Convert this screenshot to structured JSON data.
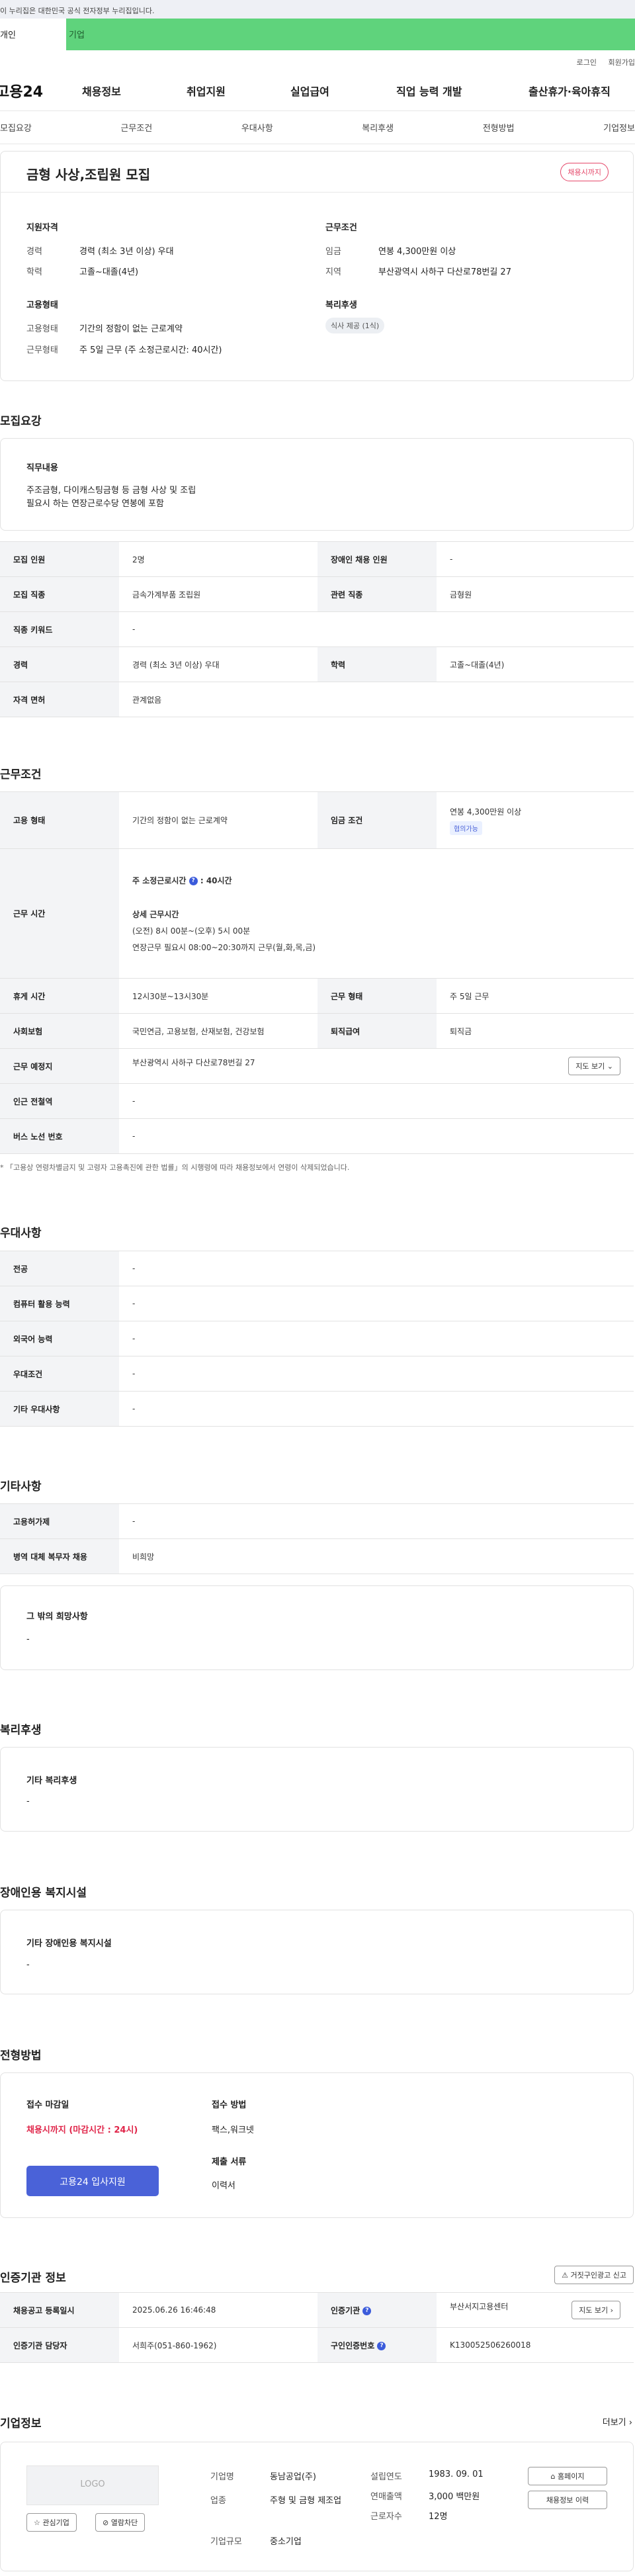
{
  "gov_banner": "이 누리집은 대한민국 공식 전자정부 누리집입니다.",
  "type_tabs": {
    "individual": "개인",
    "company": "기업"
  },
  "util": {
    "login": "로그인",
    "join": "회원가입"
  },
  "logo": "고용24",
  "gnb": [
    "채용정보",
    "취업지원",
    "실업급여",
    "직업 능력 개발",
    "출산휴가·육아휴직"
  ],
  "tabs": [
    "모집요강",
    "근무조건",
    "우대사항",
    "복리후생",
    "전형방법",
    "기업정보"
  ],
  "job": {
    "title": "금형 사상,조립원 모집",
    "badge": "채용시까지"
  },
  "summary": {
    "qual_title": "지원자격",
    "career_label": "경력",
    "career": "경력 (최소 3년 이상) 우대",
    "edu_label": "학력",
    "edu": "고졸~대졸(4년)",
    "cond_title": "근무조건",
    "wage_label": "임금",
    "wage": "연봉 4,300만원 이상",
    "area_label": "지역",
    "area": "부산광역시 사하구 다산로78번길 27",
    "emp_title": "고용형태",
    "emptype_label": "고용형태",
    "emptype": "기간의 정함이 없는 근로계약",
    "form_label": "근무형태",
    "form": "주 5일 근무 (주 소정근로시간: 40시간)",
    "welfare_title": "복리후생",
    "welfare": "식사 제공 (1식)"
  },
  "recruit": {
    "section": "모집요강",
    "duty_title": "직무내용",
    "duty_line1": "주조금형, 다이캐스팅금형 등 금형 사상 및 조립",
    "duty_line2": "필요시 하는 연장근로수당 연봉에 포함",
    "rows": [
      [
        "모집 인원",
        "2명",
        "장애인 채용 인원",
        "-"
      ],
      [
        "모집 직종",
        "금속가계부품 조립원",
        "관련 직종",
        "금형원"
      ],
      [
        "직종 키워드",
        "-"
      ],
      [
        "경력",
        "경력 (최소 3년 이상) 우대",
        "학력",
        "고졸~대졸(4년)"
      ],
      [
        "자격 면허",
        "관계없음"
      ]
    ]
  },
  "work": {
    "section": "근무조건",
    "emp_label": "고용 형태",
    "emp": "기간의 정함이 없는 근로계약",
    "wage_label": "임금 조건",
    "wage": "연봉 4,300만원 이상",
    "wage_tag": "협의가능",
    "time_label": "근무 시간",
    "weekly": "주 소정근로시간",
    "weekly_val": ": 40시간",
    "detail_title": "상세 근무시간",
    "detail1": "(오전) 8시 00분~(오후) 5시 00분",
    "detail2": "연장근무 필요시 08:00~20:30까지 근무(월,화,목,금)",
    "rest_label": "휴게 시간",
    "rest": "12시30분~13시30분",
    "form_label": "근무 형태",
    "form": "주 5일 근무",
    "ins_label": "사회보험",
    "ins": "국민연금, 고용보험, 산재보험, 건강보험",
    "sev_label": "퇴직급여",
    "sev": "퇴직금",
    "place_label": "근무 예정지",
    "place": "부산광역시 사하구 다산로78번길 27",
    "map_btn": "지도 보기",
    "sub_label": "인근 전철역",
    "sub": "-",
    "bus_label": "버스 노선 번호",
    "bus": "-",
    "note": "* 「고용상 연령차별금지 및 고령자 고용촉진에 관한 법률」의 시행령에 따라 채용정보에서 연령이 삭제되었습니다."
  },
  "pref": {
    "section": "우대사항",
    "rows": [
      [
        "전공",
        "-"
      ],
      [
        "컴퓨터 활용 능력",
        "-"
      ],
      [
        "외국어 능력",
        "-"
      ],
      [
        "우대조건",
        "-"
      ],
      [
        "기타 우대사항",
        "-"
      ]
    ]
  },
  "etc": {
    "section": "기타사항",
    "rows": [
      [
        "고용허가제",
        "-"
      ],
      [
        "병역 대체 복무자 채용",
        "비희망"
      ]
    ],
    "other_title": "그 밖의 희망사항",
    "other": "-"
  },
  "welfare": {
    "section": "복리후생",
    "title": "기타 복리후생",
    "val": "-"
  },
  "disabled": {
    "section": "장애인용 복지시설",
    "title": "기타 장애인용 복지시설",
    "val": "-"
  },
  "process": {
    "section": "전형방법",
    "deadline_title": "접수 마감일",
    "deadline": "채용시까지 (마감시간 : 24시)",
    "method_title": "접수 방법",
    "method": "팩스,워크넷",
    "docs_title": "제출 서류",
    "docs": "이력서",
    "apply": "고용24 입사지원"
  },
  "cert": {
    "section": "인증기관 정보",
    "report": "거짓구인광고 신고",
    "reg_label": "채용공고 등록일시",
    "reg": "2025.06.26 16:46:48",
    "agency_label": "인증기관",
    "agency": "부산서지고용센터",
    "map_btn": "지도 보기",
    "mgr_label": "인증기관 담당자",
    "mgr": "서희주(051-860-1962)",
    "num_label": "구인인증번호",
    "num": "K130052506260018"
  },
  "company": {
    "section": "기업정보",
    "more": "더보기",
    "logo": "LOGO",
    "fav": "관심기업",
    "block": "열람차단",
    "name_label": "기업명",
    "name": "동남공업(주)",
    "biz_label": "업종",
    "biz": "주형 및 금형 제조업",
    "size_label": "기업규모",
    "size": "중소기업",
    "year_label": "설립연도",
    "year": "1983. 09. 01",
    "sales_label": "연매출액",
    "sales": "3,000 백만원",
    "emp_label": "근로자수",
    "emp": "12명",
    "home": "홈페이지",
    "history": "채용정보 이력"
  }
}
